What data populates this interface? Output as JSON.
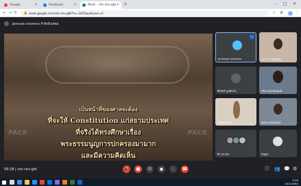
{
  "browser": {
    "tabs": [
      {
        "title": "Google",
        "active": false
      },
      {
        "title": "Facebook",
        "active": false
      },
      {
        "title": "Meet - rdx-ckv-gbt",
        "active": true
      }
    ],
    "url": "meet.google.com/rdx-ckv-gbt?hs=187&authuser=0"
  },
  "meet": {
    "owner_label": "janeaow viseenon กำลังนำเสนอ",
    "slide_lines": [
      "เป็นหน้าที่ของศาลจะต้อง",
      "ที่จะให้ Constitution แก่สยามประเทศ",
      "ที่จริงได้ทรงศึกษาเรื่อง",
      "พระธรรมนูญการปกครองมามาก",
      "และมีความคิดเห็น"
    ],
    "watermark": "PACK",
    "participants": [
      {
        "name": "janeaow viseenon",
        "selected": true
      },
      {
        "name": "นพวรา วงศ์ชัยสุข",
        "selected": false
      },
      {
        "name": "ศิริพัชร์ ภูเมืองโพ",
        "selected": false
      },
      {
        "name": "รวีพร สุขเจริญพงศ์",
        "selected": false
      },
      {
        "name": "วาศินี อ.พุทธ",
        "selected": false
      },
      {
        "name": "คมสัน ทรัพย์บูรณ์",
        "selected": false
      },
      {
        "name": "อิก 30 คน",
        "selected": false
      },
      {
        "name": "ธัญญา",
        "selected": false
      }
    ],
    "time_code": "09:28 | rdx-ckv-gbt"
  },
  "taskbar": {
    "clock_time": "9:28",
    "clock_date": "20/1/2564"
  },
  "colors": {
    "meet_bg": "#202124",
    "end_call": "#ea4335",
    "accent": "#1a73e8",
    "slide_text": "#f2d9a6"
  }
}
